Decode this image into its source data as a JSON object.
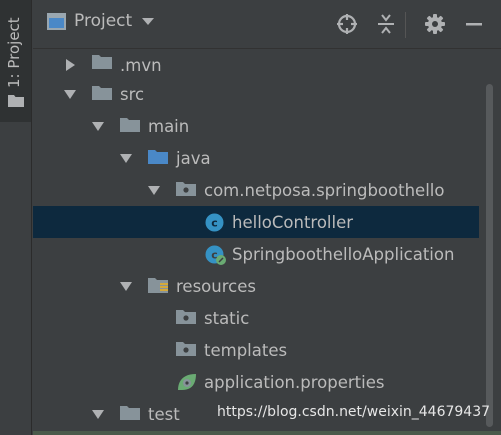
{
  "side_strip": {
    "project_tab_label": "1: Project"
  },
  "toolbar": {
    "title": "Project",
    "buttons": {
      "locate": "target-icon",
      "collapse": "collapse-all-icon",
      "settings": "gear-icon",
      "hide": "minimize-icon"
    }
  },
  "tree": {
    "items": [
      {
        "label": ".mvn",
        "expanded": false,
        "icon": "folder-icon"
      },
      {
        "label": "src",
        "expanded": true,
        "icon": "folder-icon"
      },
      {
        "label": "main",
        "expanded": true,
        "icon": "folder-icon"
      },
      {
        "label": "java",
        "expanded": true,
        "icon": "source-folder-icon"
      },
      {
        "label": "com.netposa.springboothello",
        "expanded": true,
        "icon": "package-icon"
      },
      {
        "label": "helloController",
        "selected": true,
        "icon": "java-class-icon"
      },
      {
        "label": "SpringboothelloApplication",
        "icon": "spring-boot-class-icon"
      },
      {
        "label": "resources",
        "expanded": true,
        "icon": "resources-folder-icon"
      },
      {
        "label": "static",
        "icon": "folder-icon"
      },
      {
        "label": "templates",
        "icon": "folder-icon"
      },
      {
        "label": "application.properties",
        "icon": "spring-properties-icon"
      },
      {
        "label": "test",
        "expanded": true,
        "icon": "folder-icon"
      }
    ]
  },
  "watermark": "https://blog.csdn.net/weixin_44679437",
  "colors": {
    "background": "#3c3f41",
    "selection": "#0d293e",
    "text": "#bbbbbb",
    "folder": "#87939a",
    "source_folder": "#4a88c7",
    "class_icon": "#3592c4",
    "spring": "#6aab73"
  }
}
